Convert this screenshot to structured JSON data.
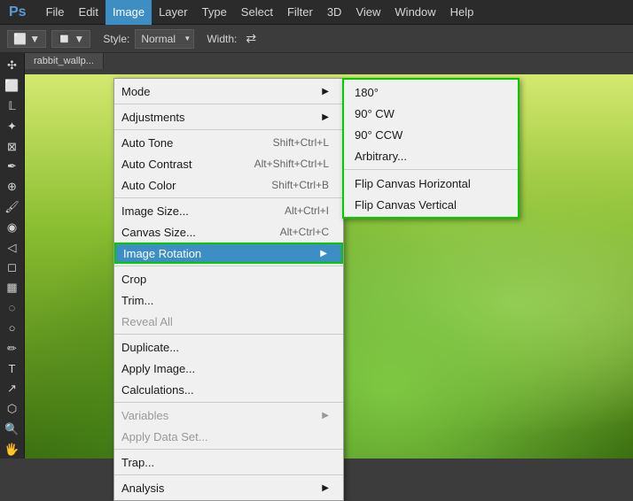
{
  "app": {
    "logo": "Ps",
    "tab_title": "rabbit_wallp..."
  },
  "menubar": {
    "items": [
      {
        "id": "ps",
        "label": "PS",
        "is_logo": true
      },
      {
        "id": "file",
        "label": "File"
      },
      {
        "id": "edit",
        "label": "Edit"
      },
      {
        "id": "image",
        "label": "Image"
      },
      {
        "id": "layer",
        "label": "Layer"
      },
      {
        "id": "type",
        "label": "Type"
      },
      {
        "id": "select",
        "label": "Select"
      },
      {
        "id": "filter",
        "label": "Filter"
      },
      {
        "id": "3d",
        "label": "3D"
      },
      {
        "id": "view",
        "label": "View"
      },
      {
        "id": "window",
        "label": "Window"
      },
      {
        "id": "help",
        "label": "Help"
      }
    ]
  },
  "toolbar": {
    "style_label": "Style:",
    "style_value": "Normal",
    "width_label": "Width:"
  },
  "image_menu": {
    "sections": [
      {
        "items": [
          {
            "id": "mode",
            "label": "Mode",
            "shortcut": "",
            "has_arrow": true,
            "disabled": false
          }
        ]
      },
      {
        "items": [
          {
            "id": "adjustments",
            "label": "Adjustments",
            "shortcut": "",
            "has_arrow": true,
            "disabled": false
          }
        ]
      },
      {
        "items": [
          {
            "id": "auto-tone",
            "label": "Auto Tone",
            "shortcut": "Shift+Ctrl+L",
            "has_arrow": false,
            "disabled": false
          },
          {
            "id": "auto-contrast",
            "label": "Auto Contrast",
            "shortcut": "Alt+Shift+Ctrl+L",
            "has_arrow": false,
            "disabled": false
          },
          {
            "id": "auto-color",
            "label": "Auto Color",
            "shortcut": "Shift+Ctrl+B",
            "has_arrow": false,
            "disabled": false
          }
        ]
      },
      {
        "items": [
          {
            "id": "image-size",
            "label": "Image Size...",
            "shortcut": "Alt+Ctrl+I",
            "has_arrow": false,
            "disabled": false
          },
          {
            "id": "canvas-size",
            "label": "Canvas Size...",
            "shortcut": "Alt+Ctrl+C",
            "has_arrow": false,
            "disabled": false
          },
          {
            "id": "image-rotation",
            "label": "Image Rotation",
            "shortcut": "",
            "has_arrow": true,
            "disabled": false,
            "highlighted": true
          }
        ]
      },
      {
        "items": [
          {
            "id": "crop",
            "label": "Crop",
            "shortcut": "",
            "has_arrow": false,
            "disabled": false
          },
          {
            "id": "trim",
            "label": "Trim...",
            "shortcut": "",
            "has_arrow": false,
            "disabled": false
          },
          {
            "id": "reveal-all",
            "label": "Reveal All",
            "shortcut": "",
            "has_arrow": false,
            "disabled": true
          }
        ]
      },
      {
        "items": [
          {
            "id": "duplicate",
            "label": "Duplicate...",
            "shortcut": "",
            "has_arrow": false,
            "disabled": false
          },
          {
            "id": "apply-image",
            "label": "Apply Image...",
            "shortcut": "",
            "has_arrow": false,
            "disabled": false
          },
          {
            "id": "calculations",
            "label": "Calculations...",
            "shortcut": "",
            "has_arrow": false,
            "disabled": false
          }
        ]
      },
      {
        "items": [
          {
            "id": "variables",
            "label": "Variables",
            "shortcut": "",
            "has_arrow": true,
            "disabled": true
          },
          {
            "id": "apply-data-set",
            "label": "Apply Data Set...",
            "shortcut": "",
            "has_arrow": false,
            "disabled": true
          }
        ]
      },
      {
        "items": [
          {
            "id": "trap",
            "label": "Trap...",
            "shortcut": "",
            "has_arrow": false,
            "disabled": false
          }
        ]
      },
      {
        "items": [
          {
            "id": "analysis",
            "label": "Analysis",
            "shortcut": "",
            "has_arrow": true,
            "disabled": false
          }
        ]
      }
    ]
  },
  "rotation_submenu": {
    "items": [
      {
        "id": "180",
        "label": "180°"
      },
      {
        "id": "90cw",
        "label": "90° CW"
      },
      {
        "id": "90ccw",
        "label": "90° CCW"
      },
      {
        "id": "arbitrary",
        "label": "Arbitrary..."
      },
      {
        "id": "flip-horizontal",
        "label": "Flip Canvas Horizontal"
      },
      {
        "id": "flip-vertical",
        "label": "Flip Canvas Vertical"
      }
    ]
  },
  "tools": [
    "✂",
    "◻",
    "⊕",
    "✏",
    "🖌",
    "◉",
    "✦",
    "↗",
    "🔍",
    "🤚"
  ]
}
